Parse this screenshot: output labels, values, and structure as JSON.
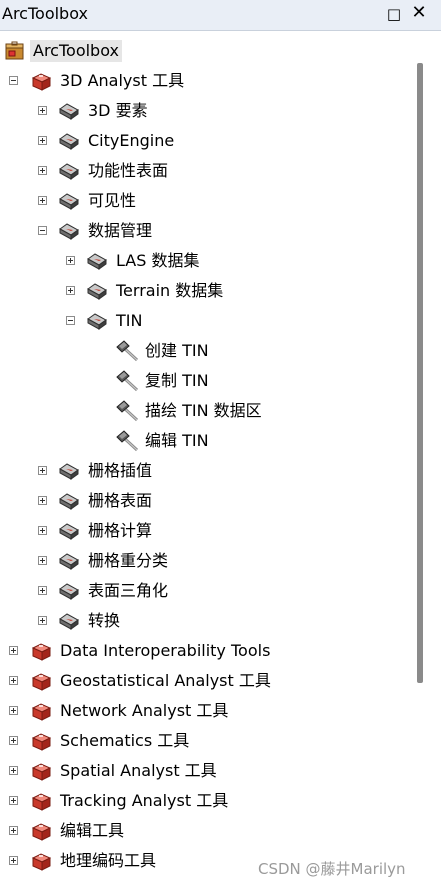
{
  "window": {
    "title": "ArcToolbox",
    "float_glyph": "□",
    "close_glyph": "✕"
  },
  "tree": [
    {
      "label": "ArcToolbox",
      "level": 0,
      "icon": "toolbox-root-icon",
      "expander": "none",
      "name": "root"
    },
    {
      "label": "3D Analyst 工具",
      "level": 1,
      "icon": "toolbox-red-icon",
      "expander": "minus",
      "name": "3d-analyst"
    },
    {
      "label": "3D 要素",
      "level": 2,
      "icon": "toolset-icon",
      "expander": "plus",
      "name": "3d-features"
    },
    {
      "label": "CityEngine",
      "level": 2,
      "icon": "toolset-icon",
      "expander": "plus",
      "name": "cityengine"
    },
    {
      "label": "功能性表面",
      "level": 2,
      "icon": "toolset-icon",
      "expander": "plus",
      "name": "functional-surface"
    },
    {
      "label": "可见性",
      "level": 2,
      "icon": "toolset-icon",
      "expander": "plus",
      "name": "visibility"
    },
    {
      "label": "数据管理",
      "level": 2,
      "icon": "toolset-icon",
      "expander": "minus",
      "name": "data-management"
    },
    {
      "label": "LAS 数据集",
      "level": 3,
      "icon": "toolset-icon",
      "expander": "plus",
      "name": "las-dataset"
    },
    {
      "label": "Terrain 数据集",
      "level": 3,
      "icon": "toolset-icon",
      "expander": "plus",
      "name": "terrain-dataset"
    },
    {
      "label": "TIN",
      "level": 3,
      "icon": "toolset-icon",
      "expander": "minus",
      "name": "tin"
    },
    {
      "label": "创建 TIN",
      "level": 4,
      "icon": "hammer-icon",
      "expander": "none",
      "name": "create-tin"
    },
    {
      "label": "复制 TIN",
      "level": 4,
      "icon": "hammer-icon",
      "expander": "none",
      "name": "copy-tin"
    },
    {
      "label": "描绘 TIN 数据区",
      "level": 4,
      "icon": "hammer-icon",
      "expander": "none",
      "name": "delineate-tin-data-area"
    },
    {
      "label": "编辑 TIN",
      "level": 4,
      "icon": "hammer-icon",
      "expander": "none",
      "name": "edit-tin"
    },
    {
      "label": "栅格插值",
      "level": 2,
      "icon": "toolset-icon",
      "expander": "plus",
      "name": "raster-interpolation"
    },
    {
      "label": "栅格表面",
      "level": 2,
      "icon": "toolset-icon",
      "expander": "plus",
      "name": "raster-surface"
    },
    {
      "label": "栅格计算",
      "level": 2,
      "icon": "toolset-icon",
      "expander": "plus",
      "name": "raster-math"
    },
    {
      "label": "栅格重分类",
      "level": 2,
      "icon": "toolset-icon",
      "expander": "plus",
      "name": "raster-reclass"
    },
    {
      "label": "表面三角化",
      "level": 2,
      "icon": "toolset-icon",
      "expander": "plus",
      "name": "surface-triangulation"
    },
    {
      "label": "转换",
      "level": 2,
      "icon": "toolset-icon",
      "expander": "plus",
      "name": "conversion"
    },
    {
      "label": "Data Interoperability Tools",
      "level": 1,
      "icon": "toolbox-red-icon",
      "expander": "plus",
      "name": "data-interoperability"
    },
    {
      "label": "Geostatistical Analyst 工具",
      "level": 1,
      "icon": "toolbox-red-icon",
      "expander": "plus",
      "name": "geostatistical-analyst"
    },
    {
      "label": "Network Analyst 工具",
      "level": 1,
      "icon": "toolbox-red-icon",
      "expander": "plus",
      "name": "network-analyst"
    },
    {
      "label": "Schematics 工具",
      "level": 1,
      "icon": "toolbox-red-icon",
      "expander": "plus",
      "name": "schematics"
    },
    {
      "label": "Spatial Analyst 工具",
      "level": 1,
      "icon": "toolbox-red-icon",
      "expander": "plus",
      "name": "spatial-analyst"
    },
    {
      "label": "Tracking Analyst 工具",
      "level": 1,
      "icon": "toolbox-red-icon",
      "expander": "plus",
      "name": "tracking-analyst"
    },
    {
      "label": "编辑工具",
      "level": 1,
      "icon": "toolbox-red-icon",
      "expander": "plus",
      "name": "editing-tools"
    },
    {
      "label": "地理编码工具",
      "level": 1,
      "icon": "toolbox-red-icon",
      "expander": "plus",
      "name": "geocoding-tools"
    }
  ],
  "watermark": "CSDN @藤井Marilyn"
}
